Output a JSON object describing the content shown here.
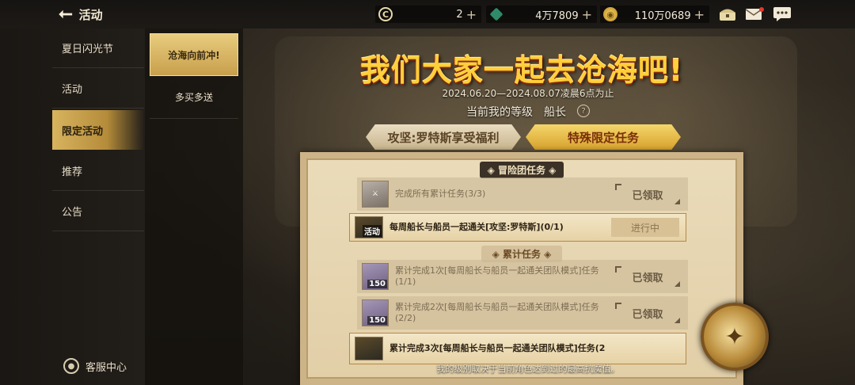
{
  "topbar": {
    "back_icon": "back-arrow-icon",
    "title": "活动",
    "resources": [
      {
        "icon": "coin-c-icon",
        "value": "2"
      },
      {
        "icon": "crystal-icon",
        "value": "4万7809"
      },
      {
        "icon": "gold-coin-icon",
        "value": "110万0689"
      }
    ],
    "plus": "+",
    "icons": [
      "chest-icon",
      "mail-icon",
      "chat-icon"
    ]
  },
  "sidebar": {
    "items": [
      {
        "label": "夏日闪光节"
      },
      {
        "label": "活动"
      },
      {
        "label": "限定活动"
      },
      {
        "label": "推荐"
      },
      {
        "label": "公告"
      }
    ],
    "active_index": 2,
    "service": "客服中心"
  },
  "subtabs": {
    "items": [
      {
        "label": "沧海向前冲!"
      },
      {
        "label": "多买多送"
      }
    ]
  },
  "event": {
    "title": "我们大家一起去沧海吧!",
    "date": "2024.06.20—2024.08.07凌晨6点为止",
    "level_label": "当前我的等级",
    "level_value": "船长",
    "help": "?",
    "tabs": [
      {
        "label": "攻坚:罗特斯享受福利"
      },
      {
        "label": "特殊限定任务"
      }
    ],
    "section1": "冒险团任务",
    "section2": "累计任务",
    "tasks": [
      {
        "icon": "sword-icon",
        "badge": "",
        "text": "完成所有累计任务(3/3)",
        "status": "已领取"
      },
      {
        "icon": "activity-icon",
        "badge": "活动",
        "text": "每周船长与船员一起通关[攻坚:罗特斯](0/1)",
        "status": "进行中"
      },
      {
        "icon": "reward-icon",
        "badge": "150",
        "text": "累计完成1次[每周船长与船员一起通关团队模式]任务(1/1)",
        "status": "已领取"
      },
      {
        "icon": "reward-icon",
        "badge": "150",
        "text": "累计完成2次[每周船长与船员一起通关团队模式]任务(2/2)",
        "status": "已领取"
      },
      {
        "icon": "activity-icon",
        "badge": "",
        "text": "累计完成3次[每周船长与船员一起通关团队模式]任务(2",
        "status": ""
      }
    ],
    "footer_note": "我的级别取决于当前角色达到过的最高抗魔值。"
  }
}
